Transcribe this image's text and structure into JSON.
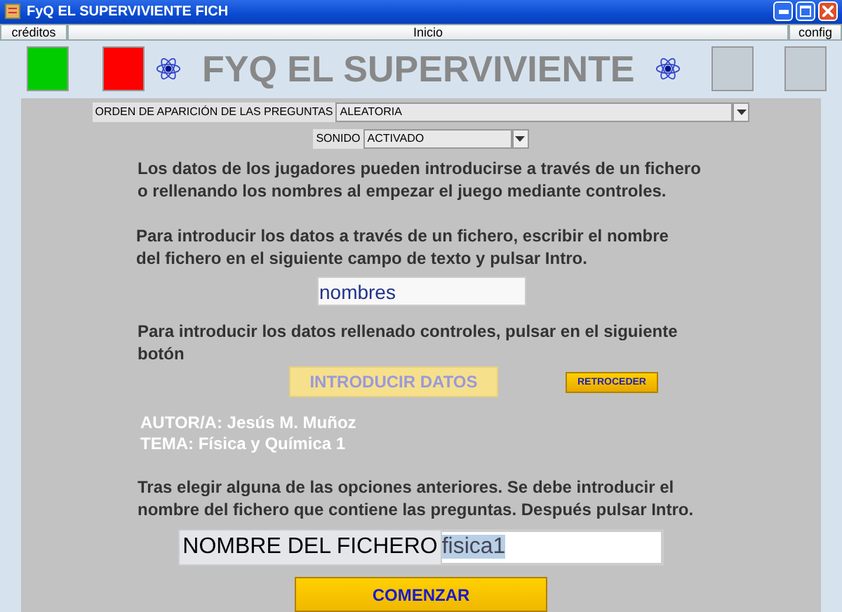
{
  "window": {
    "title": "FyQ EL SUPERVIVIENTE FICH"
  },
  "menu_buttons": [
    {
      "label": "créditos",
      "kind": "side"
    },
    {
      "label": "Inicio",
      "kind": "center"
    },
    {
      "label": "config",
      "kind": "side"
    }
  ],
  "header": {
    "title": "FYQ EL SUPERVIVIENTE",
    "left_squares": [
      {
        "color": "#00cc00"
      },
      {
        "color": "#ff0000"
      }
    ],
    "right_squares": [
      {
        "color": "#c4ccd4"
      },
      {
        "color": "#c4ccd4"
      }
    ]
  },
  "order_select": {
    "label": "ORDEN DE APARICIÓN DE LAS PREGUNTAS",
    "value": "ALEATORIA"
  },
  "sound_select": {
    "label": "SONIDO",
    "value": "ACTIVADO"
  },
  "intro_text": "Los datos de los jugadores pueden introducirse a través de un fichero o rellenando los nombres al empezar el juego mediante controles.",
  "file_text": "Para introducir los datos a través de un fichero, escribir el nombre del fichero en el siguiente campo de texto y pulsar Intro.",
  "players_file_field": {
    "value": "nombres"
  },
  "controls_text": "Para introducir los datos rellenado controles, pulsar en el siguiente botón",
  "introduce_button": {
    "label": "INTRODUCIR DATOS",
    "disabled": true
  },
  "back_button": {
    "label": "RETROCEDER"
  },
  "author": "AUTOR/A: Jesús M. Muñoz",
  "topic": "TEMA: Física y Química 1",
  "questions_text": "Tras elegir alguna de las opciones anteriores. Se debe introducir el nombre del fichero que contiene las preguntas. Después pulsar Intro.",
  "questions_file": {
    "label": "NOMBRE DEL FICHERO",
    "value": "fisica1"
  },
  "start_button": {
    "label": "COMENZAR"
  }
}
